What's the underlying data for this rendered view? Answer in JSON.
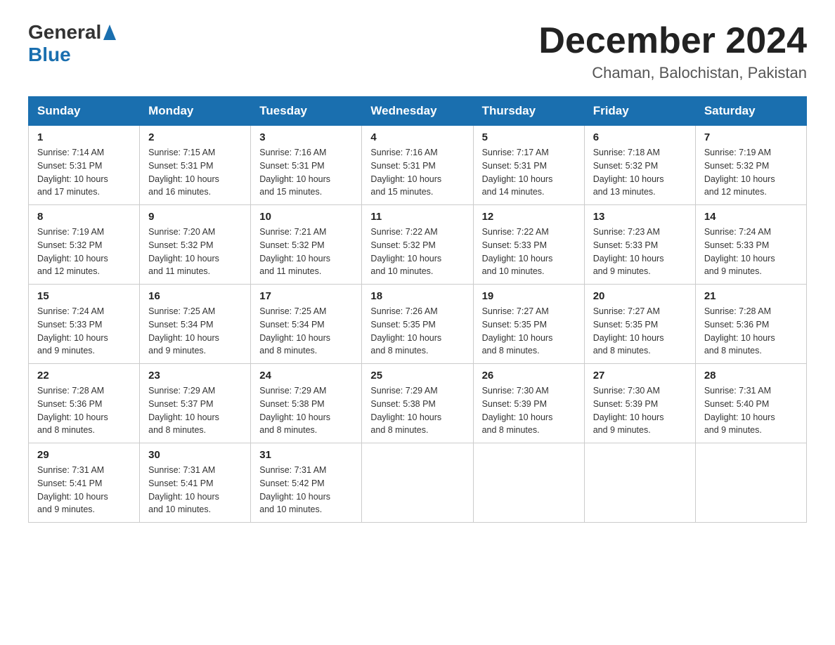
{
  "header": {
    "logo": {
      "text_general": "General",
      "text_blue": "Blue",
      "alt": "GeneralBlue logo"
    },
    "title": "December 2024",
    "location": "Chaman, Balochistan, Pakistan"
  },
  "calendar": {
    "days_of_week": [
      "Sunday",
      "Monday",
      "Tuesday",
      "Wednesday",
      "Thursday",
      "Friday",
      "Saturday"
    ],
    "weeks": [
      [
        {
          "day": "1",
          "sunrise": "7:14 AM",
          "sunset": "5:31 PM",
          "daylight": "10 hours and 17 minutes."
        },
        {
          "day": "2",
          "sunrise": "7:15 AM",
          "sunset": "5:31 PM",
          "daylight": "10 hours and 16 minutes."
        },
        {
          "day": "3",
          "sunrise": "7:16 AM",
          "sunset": "5:31 PM",
          "daylight": "10 hours and 15 minutes."
        },
        {
          "day": "4",
          "sunrise": "7:16 AM",
          "sunset": "5:31 PM",
          "daylight": "10 hours and 15 minutes."
        },
        {
          "day": "5",
          "sunrise": "7:17 AM",
          "sunset": "5:31 PM",
          "daylight": "10 hours and 14 minutes."
        },
        {
          "day": "6",
          "sunrise": "7:18 AM",
          "sunset": "5:32 PM",
          "daylight": "10 hours and 13 minutes."
        },
        {
          "day": "7",
          "sunrise": "7:19 AM",
          "sunset": "5:32 PM",
          "daylight": "10 hours and 12 minutes."
        }
      ],
      [
        {
          "day": "8",
          "sunrise": "7:19 AM",
          "sunset": "5:32 PM",
          "daylight": "10 hours and 12 minutes."
        },
        {
          "day": "9",
          "sunrise": "7:20 AM",
          "sunset": "5:32 PM",
          "daylight": "10 hours and 11 minutes."
        },
        {
          "day": "10",
          "sunrise": "7:21 AM",
          "sunset": "5:32 PM",
          "daylight": "10 hours and 11 minutes."
        },
        {
          "day": "11",
          "sunrise": "7:22 AM",
          "sunset": "5:32 PM",
          "daylight": "10 hours and 10 minutes."
        },
        {
          "day": "12",
          "sunrise": "7:22 AM",
          "sunset": "5:33 PM",
          "daylight": "10 hours and 10 minutes."
        },
        {
          "day": "13",
          "sunrise": "7:23 AM",
          "sunset": "5:33 PM",
          "daylight": "10 hours and 9 minutes."
        },
        {
          "day": "14",
          "sunrise": "7:24 AM",
          "sunset": "5:33 PM",
          "daylight": "10 hours and 9 minutes."
        }
      ],
      [
        {
          "day": "15",
          "sunrise": "7:24 AM",
          "sunset": "5:33 PM",
          "daylight": "10 hours and 9 minutes."
        },
        {
          "day": "16",
          "sunrise": "7:25 AM",
          "sunset": "5:34 PM",
          "daylight": "10 hours and 9 minutes."
        },
        {
          "day": "17",
          "sunrise": "7:25 AM",
          "sunset": "5:34 PM",
          "daylight": "10 hours and 8 minutes."
        },
        {
          "day": "18",
          "sunrise": "7:26 AM",
          "sunset": "5:35 PM",
          "daylight": "10 hours and 8 minutes."
        },
        {
          "day": "19",
          "sunrise": "7:27 AM",
          "sunset": "5:35 PM",
          "daylight": "10 hours and 8 minutes."
        },
        {
          "day": "20",
          "sunrise": "7:27 AM",
          "sunset": "5:35 PM",
          "daylight": "10 hours and 8 minutes."
        },
        {
          "day": "21",
          "sunrise": "7:28 AM",
          "sunset": "5:36 PM",
          "daylight": "10 hours and 8 minutes."
        }
      ],
      [
        {
          "day": "22",
          "sunrise": "7:28 AM",
          "sunset": "5:36 PM",
          "daylight": "10 hours and 8 minutes."
        },
        {
          "day": "23",
          "sunrise": "7:29 AM",
          "sunset": "5:37 PM",
          "daylight": "10 hours and 8 minutes."
        },
        {
          "day": "24",
          "sunrise": "7:29 AM",
          "sunset": "5:38 PM",
          "daylight": "10 hours and 8 minutes."
        },
        {
          "day": "25",
          "sunrise": "7:29 AM",
          "sunset": "5:38 PM",
          "daylight": "10 hours and 8 minutes."
        },
        {
          "day": "26",
          "sunrise": "7:30 AM",
          "sunset": "5:39 PM",
          "daylight": "10 hours and 8 minutes."
        },
        {
          "day": "27",
          "sunrise": "7:30 AM",
          "sunset": "5:39 PM",
          "daylight": "10 hours and 9 minutes."
        },
        {
          "day": "28",
          "sunrise": "7:31 AM",
          "sunset": "5:40 PM",
          "daylight": "10 hours and 9 minutes."
        }
      ],
      [
        {
          "day": "29",
          "sunrise": "7:31 AM",
          "sunset": "5:41 PM",
          "daylight": "10 hours and 9 minutes."
        },
        {
          "day": "30",
          "sunrise": "7:31 AM",
          "sunset": "5:41 PM",
          "daylight": "10 hours and 10 minutes."
        },
        {
          "day": "31",
          "sunrise": "7:31 AM",
          "sunset": "5:42 PM",
          "daylight": "10 hours and 10 minutes."
        },
        null,
        null,
        null,
        null
      ]
    ],
    "labels": {
      "sunrise": "Sunrise:",
      "sunset": "Sunset:",
      "daylight": "Daylight:"
    }
  }
}
